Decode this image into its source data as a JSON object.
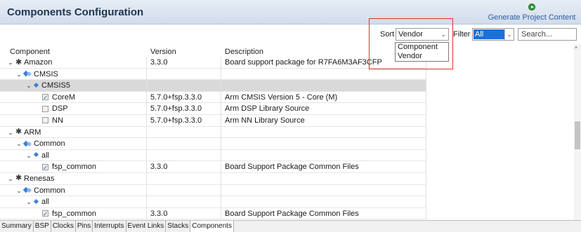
{
  "header": {
    "title": "Components Configuration",
    "generate_label": "Generate Project Content"
  },
  "toolbar": {
    "sort_label": "Sort",
    "sort_value": "Vendor",
    "sort_options": [
      "Component",
      "Vendor"
    ],
    "filter_label": "Filter",
    "filter_value": "All",
    "search_placeholder": "Search..."
  },
  "table": {
    "columns": [
      "Component",
      "Version",
      "Description"
    ],
    "rows": [
      {
        "kind": "vendor",
        "name": "Amazon",
        "version": "3.3.0",
        "description": "Board support package for R7FA6M3AF3CFP"
      },
      {
        "kind": "class",
        "name": "CMSIS",
        "version": "",
        "description": ""
      },
      {
        "kind": "group",
        "name": "CMSIS5",
        "version": "",
        "description": "",
        "selected": true
      },
      {
        "kind": "item",
        "name": "CoreM",
        "checked": true,
        "version": "5.7.0+fsp.3.3.0",
        "description": "Arm CMSIS Version 5 - Core (M)"
      },
      {
        "kind": "item",
        "name": "DSP",
        "checked": false,
        "version": "5.7.0+fsp.3.3.0",
        "description": "Arm DSP Library Source"
      },
      {
        "kind": "item",
        "name": "NN",
        "checked": false,
        "version": "5.7.0+fsp.3.3.0",
        "description": "Arm NN Library Source"
      },
      {
        "kind": "vendor",
        "name": "ARM",
        "version": "",
        "description": ""
      },
      {
        "kind": "class",
        "name": "Common",
        "version": "",
        "description": ""
      },
      {
        "kind": "group",
        "name": "all",
        "version": "",
        "description": ""
      },
      {
        "kind": "item",
        "name": "fsp_common",
        "checked": true,
        "version": "3.3.0",
        "description": "Board Support Package Common Files"
      },
      {
        "kind": "vendor",
        "name": "Renesas",
        "version": "",
        "description": ""
      },
      {
        "kind": "class",
        "name": "Common",
        "version": "",
        "description": ""
      },
      {
        "kind": "group",
        "name": "all",
        "version": "",
        "description": ""
      },
      {
        "kind": "item",
        "name": "fsp_common",
        "checked": true,
        "version": "3.3.0",
        "description": "Board Support Package Common Files"
      }
    ]
  },
  "tabs": [
    "Summary",
    "BSP",
    "Clocks",
    "Pins",
    "Interrupts",
    "Event Links",
    "Stacks",
    "Components"
  ],
  "active_tab": "Components",
  "colors": {
    "accent": "#1e6fd9",
    "highlight_box": "#e0302a",
    "link": "#2a5ea8"
  }
}
